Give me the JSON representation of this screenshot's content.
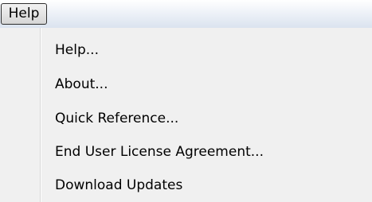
{
  "menubar": {
    "active_menu": "Help"
  },
  "dropdown": {
    "items": [
      {
        "label": "Help..."
      },
      {
        "label": "About..."
      },
      {
        "label": "Quick Reference..."
      },
      {
        "label": "End User License Agreement..."
      },
      {
        "label": "Download Updates"
      }
    ]
  }
}
